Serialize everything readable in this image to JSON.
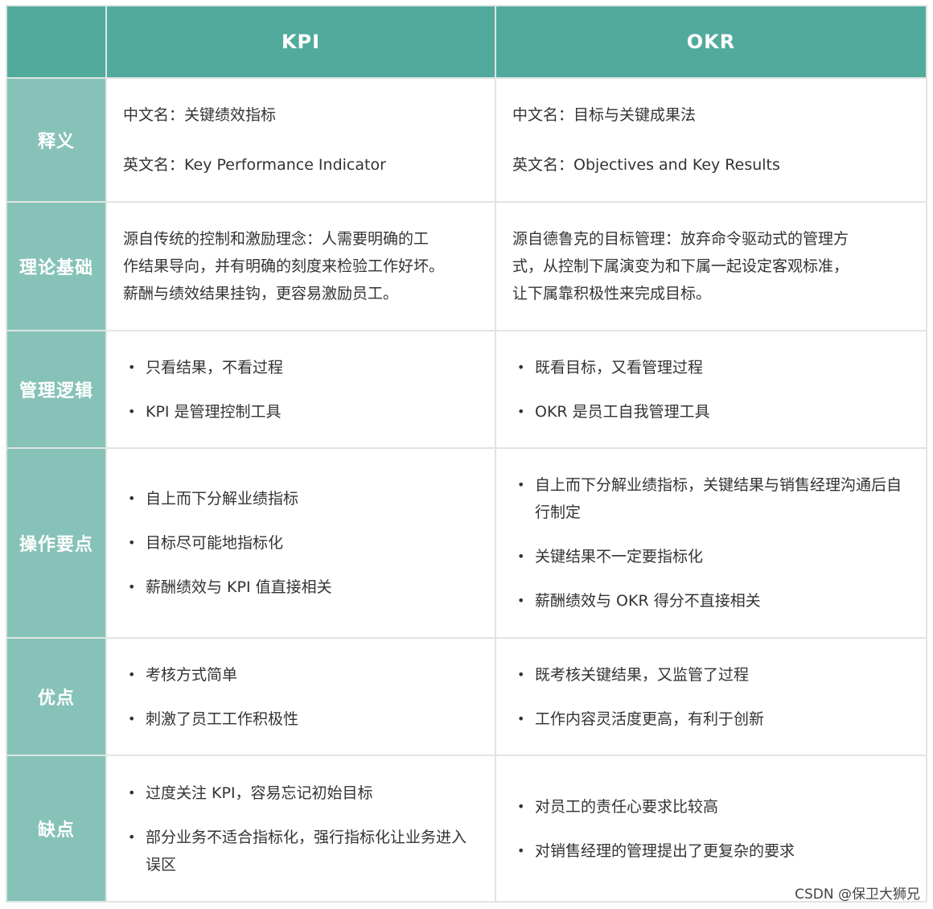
{
  "header": {
    "corner": "",
    "col1": "KPI",
    "col2": "OKR"
  },
  "rows": [
    {
      "label": "释义",
      "kpi_lines": [
        "中文名：关键绩效指标",
        "英文名：Key Performance Indicator"
      ],
      "okr_lines": [
        "中文名：目标与关键成果法",
        "英文名：Objectives and Key Results"
      ]
    },
    {
      "label": "理论基础",
      "kpi_lines": [
        "源自传统的控制和激励理念：人需要明确的工",
        "作结果导向，并有明确的刻度来检验工作好坏。",
        "薪酬与绩效结果挂钩，更容易激励员工。"
      ],
      "okr_lines": [
        "源自德鲁克的目标管理：放弃命令驱动式的管理方",
        "式，从控制下属演变为和下属一起设定客观标准，",
        "让下属靠积极性来完成目标。"
      ]
    },
    {
      "label": "管理逻辑",
      "kpi_items": [
        "只看结果，不看过程",
        "KPI 是管理控制工具"
      ],
      "okr_items": [
        "既看目标，又看管理过程",
        "OKR 是员工自我管理工具"
      ]
    },
    {
      "label": "操作要点",
      "kpi_items": [
        "自上而下分解业绩指标",
        "目标尽可能地指标化",
        "薪酬绩效与 KPI 值直接相关"
      ],
      "okr_items": [
        "自上而下分解业绩指标，关键结果与销售经理沟通后自行制定",
        "关键结果不一定要指标化",
        "薪酬绩效与 OKR 得分不直接相关"
      ]
    },
    {
      "label": "优点",
      "kpi_items": [
        "考核方式简单",
        "刺激了员工工作积极性"
      ],
      "okr_items": [
        "既考核关键结果，又监管了过程",
        "工作内容灵活度更高，有利于创新"
      ]
    },
    {
      "label": "缺点",
      "kpi_items": [
        "过度关注 KPI，容易忘记初始目标",
        "部分业务不适合指标化，强行指标化让业务进入误区"
      ],
      "okr_items": [
        "对员工的责任心要求比较高",
        "对销售经理的管理提出了更复杂的要求"
      ]
    }
  ],
  "bullet_glyph": "•",
  "watermark": "CSDN @保卫大狮兄",
  "colors": {
    "header_bg": "#51aa9c",
    "row_head_bg": "#86c2b8",
    "border": "#dfe5e3"
  }
}
